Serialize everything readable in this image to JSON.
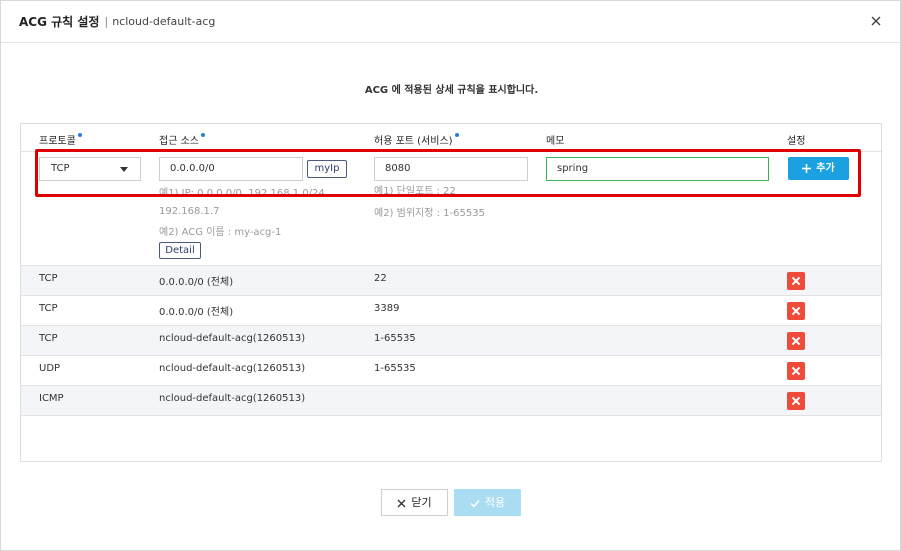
{
  "modal": {
    "title": "ACG 규칙 설정",
    "separator": "|",
    "subtitle": "ncloud-default-acg"
  },
  "description": "ACG 에 적용된 상세 규칙을 표시합니다.",
  "columns": {
    "protocol": "프로토콜",
    "source": "접근 소스",
    "port": "허용 포트 (서비스)",
    "memo": "메모",
    "setting": "설정"
  },
  "form": {
    "protocol": "TCP",
    "source": "0.0.0.0/0",
    "myip_label": "myIp",
    "port": "8080",
    "memo": "spring",
    "add_label": "추가",
    "hint_source_1": "예1) IP: 0.0.0.0/0, 192.168.1.0/24,",
    "hint_source_2": "192.168.1.7",
    "hint_source_3": "예2) ACG 이름 : my-acg-1",
    "hint_port_1": "예1) 단일포트 : 22",
    "hint_port_2": "예2) 범위지정 : 1-65535",
    "detail_label": "Detail"
  },
  "rules": [
    {
      "protocol": "TCP",
      "source": "0.0.0.0/0 (전체)",
      "port": "22"
    },
    {
      "protocol": "TCP",
      "source": "0.0.0.0/0 (전체)",
      "port": "3389"
    },
    {
      "protocol": "TCP",
      "source": "ncloud-default-acg(1260513)",
      "port": "1-65535"
    },
    {
      "protocol": "UDP",
      "source": "ncloud-default-acg(1260513)",
      "port": "1-65535"
    },
    {
      "protocol": "ICMP",
      "source": "ncloud-default-acg(1260513)",
      "port": ""
    }
  ],
  "footer": {
    "close_label": "닫기",
    "apply_label": "적용"
  },
  "colors": {
    "accent": "#1ba0e2",
    "delete": "#f04a3a",
    "highlight": "#e00000",
    "memo_border": "#39b55a"
  }
}
